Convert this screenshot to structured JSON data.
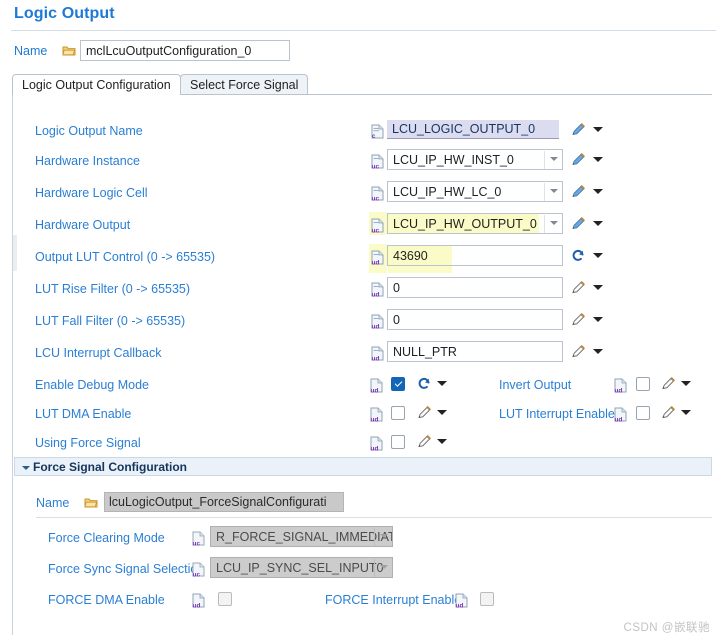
{
  "page": {
    "title": "Logic Output",
    "watermark": "CSDN @嵌联驰"
  },
  "top_name": {
    "label": "Name",
    "value": "mclLcuOutputConfiguration_0",
    "icon": "folder-icon"
  },
  "tabs": [
    {
      "label": "Logic Output Configuration",
      "selected": true
    },
    {
      "label": "Select Force Signal",
      "selected": false
    }
  ],
  "fields": [
    {
      "label": "Logic Output Name",
      "control": "text",
      "value": "LCU_LOGIC_OUTPUT_0",
      "style": "lavender",
      "icon": "config-doc-icon",
      "edit_icon": "pencil-blue-icon"
    },
    {
      "label": "Hardware Instance",
      "control": "combo",
      "value": "LCU_IP_HW_INST_0",
      "icon": "uc-doc-icon",
      "edit_icon": "pencil-blue-icon"
    },
    {
      "label": "Hardware Logic Cell",
      "control": "combo",
      "value": "LCU_IP_HW_LC_0",
      "icon": "uc-doc-icon",
      "edit_icon": "pencil-blue-icon"
    },
    {
      "label": "Hardware Output",
      "control": "combo",
      "value": "LCU_IP_HW_OUTPUT_0",
      "highlight": true,
      "icon": "uc-doc-icon",
      "edit_icon": "pencil-blue-icon"
    },
    {
      "label": "Output LUT Control (0 -> 65535)",
      "control": "text",
      "value": "43690",
      "highlight": true,
      "icon": "ud-doc-icon",
      "edit_icon": "revert-icon"
    },
    {
      "label": "LUT Rise Filter (0 -> 65535)",
      "control": "text",
      "value": "0",
      "icon": "ud-doc-icon",
      "edit_icon": "pencil-icon"
    },
    {
      "label": "LUT Fall Filter (0 -> 65535)",
      "control": "text",
      "value": "0",
      "icon": "ud-doc-icon",
      "edit_icon": "pencil-icon"
    },
    {
      "label": "LCU Interrupt Callback",
      "control": "text",
      "value": "NULL_PTR",
      "icon": "ud-doc-icon",
      "edit_icon": "pencil-icon"
    }
  ],
  "checkbox_rows": [
    {
      "label": "Enable Debug Mode",
      "checked": true,
      "icon": "ud-doc-icon",
      "edit_icon": "revert-icon",
      "right": {
        "label": "Invert Output",
        "checked": false,
        "icon": "ud-doc-icon",
        "edit_icon": "pencil-icon"
      }
    },
    {
      "label": "LUT DMA Enable",
      "checked": false,
      "icon": "ud-doc-icon",
      "edit_icon": "pencil-icon",
      "right": {
        "label": "LUT Interrupt Enable",
        "checked": false,
        "icon": "ud-doc-icon",
        "edit_icon": "pencil-icon"
      }
    },
    {
      "label": "Using Force Signal",
      "checked": false,
      "icon": "ud-doc-icon",
      "edit_icon": "pencil-icon",
      "right": null
    }
  ],
  "section": {
    "title": "Force Signal Configuration",
    "expanded": true,
    "name": {
      "label": "Name",
      "value": "lcuLogicOutput_ForceSignalConfigurati",
      "icon": "folder-icon",
      "disabled": true
    },
    "fields": [
      {
        "label": "Force Clearing Mode",
        "control": "combo",
        "value": "R_FORCE_SIGNAL_IMMEDIATE",
        "disabled": true,
        "icon": "uc-doc-icon"
      },
      {
        "label": "Force Sync Signal Selection",
        "control": "combo",
        "value": "LCU_IP_SYNC_SEL_INPUT0",
        "disabled": true,
        "icon": "uc-doc-icon"
      }
    ],
    "checkbox_row": {
      "label": "FORCE DMA Enable",
      "checked": false,
      "icon": "ud-doc-icon",
      "right": {
        "label": "FORCE Interrupt Enable",
        "checked": false,
        "icon": "ud-doc-icon"
      }
    }
  },
  "colors": {
    "title_blue": "#1c7ad6",
    "label_blue": "#2a7fd4",
    "highlight_yellow": "#fbfbc8",
    "lavender": "#dcdcf0",
    "checkbox_checked": "#1266b5",
    "section_bg": "#eaf1f8"
  }
}
